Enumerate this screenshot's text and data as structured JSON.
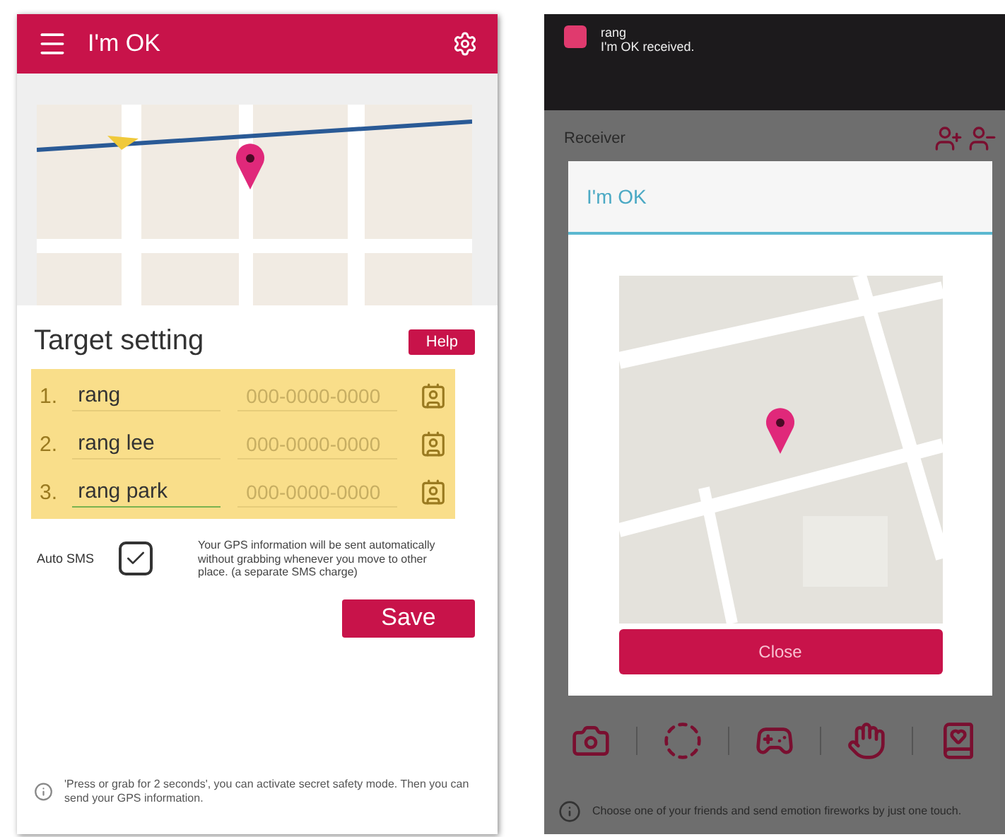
{
  "left_screen": {
    "app_bar": {
      "title": "I'm OK"
    },
    "section_title": "Target setting",
    "help_button": "Help",
    "contacts": [
      {
        "number": "1.",
        "name": "rang",
        "phone_placeholder": "000-0000-0000",
        "focused": false
      },
      {
        "number": "2.",
        "name": "rang lee",
        "phone_placeholder": "000-0000-0000",
        "focused": false
      },
      {
        "number": "3.",
        "name": "rang park",
        "phone_placeholder": "000-0000-0000",
        "focused": true
      }
    ],
    "auto_sms": {
      "label": "Auto SMS",
      "checked": true,
      "note": "Your GPS information will be sent automatically without grabbing whenever you move to other place. (a separate SMS charge)"
    },
    "save_button": "Save",
    "info": "'Press or grab for 2 seconds', you can activate secret safety mode. Then you can send your GPS information."
  },
  "right_screen": {
    "notification": {
      "sender": "rang",
      "message": "I'm OK received."
    },
    "receiver_label": "Receiver",
    "dialog": {
      "title": "I'm OK",
      "close_button": "Close"
    },
    "info": "Choose one of your friends and send emotion fireworks by just one touch."
  }
}
